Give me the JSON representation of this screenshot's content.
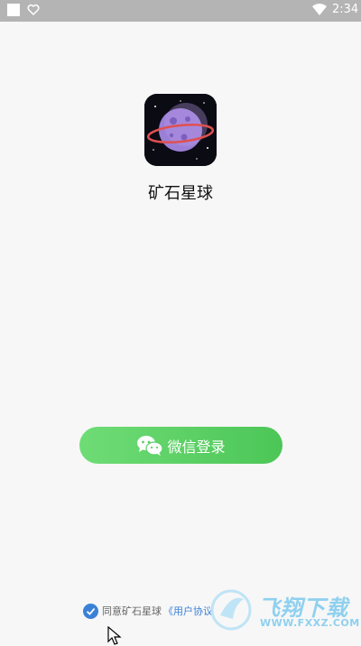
{
  "status_bar": {
    "time": "2:34",
    "icons": [
      "square-icon",
      "heart-icon",
      "wifi-icon"
    ]
  },
  "app": {
    "name": "矿石星球",
    "icon": "planet-icon"
  },
  "login": {
    "label": "微信登录",
    "icon": "wechat-icon"
  },
  "agreement": {
    "text": "同意矿石星球",
    "link": "《用户协议",
    "checked": true
  },
  "watermark": {
    "title": "飞翔下载",
    "url": "WWW.FXXZ.COM"
  },
  "colors": {
    "button_start": "#6fdc76",
    "button_end": "#4cc657",
    "link": "#3b82d6",
    "check": "#3b82d6"
  }
}
